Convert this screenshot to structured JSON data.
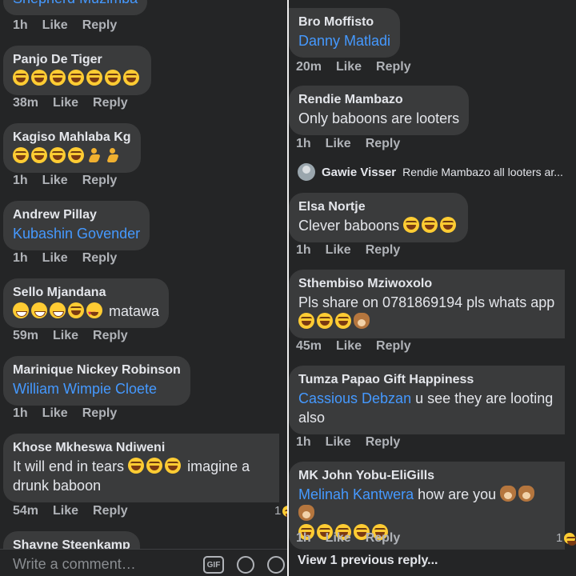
{
  "left": {
    "top_cut_author": "Shepherd Muzimba",
    "top_cut_actions": {
      "time": "1h",
      "like": "Like",
      "reply": "Reply"
    },
    "comments": [
      {
        "author": "Panjo De Tiger",
        "text": "",
        "mention": "",
        "time": "38m",
        "like": "Like",
        "reply": "Reply"
      },
      {
        "author": "Kagiso Mahlaba Kg",
        "text": "",
        "mention": "",
        "time": "1h",
        "like": "Like",
        "reply": "Reply"
      },
      {
        "author": "Andrew Pillay",
        "text": "",
        "mention": "Kubashin Govender",
        "time": "1h",
        "like": "Like",
        "reply": "Reply"
      },
      {
        "author": "Sello Mjandana",
        "text": "matawa",
        "mention": "",
        "time": "59m",
        "like": "Like",
        "reply": "Reply"
      },
      {
        "author": "Marinique Nickey Robinson",
        "text": "",
        "mention": "William Wimpie Cloete",
        "time": "1h",
        "like": "Like",
        "reply": "Reply"
      },
      {
        "author": "Khose Mkheswa Ndiweni",
        "text_a": "It will end in tears",
        "text_b": "imagine a",
        "text_c": "drunk baboon",
        "time": "54m",
        "like": "Like",
        "reply": "Reply",
        "reaction_count": "1"
      },
      {
        "author": "Shayne Steenkamp"
      }
    ],
    "composer": {
      "placeholder": "Write a comment…",
      "gif": "GIF"
    }
  },
  "right": {
    "comments": [
      {
        "author": "Bro Moffisto",
        "mention": "Danny Matladi",
        "time": "20m",
        "like": "Like",
        "reply": "Reply"
      },
      {
        "author": "Rendie Mambazo",
        "text": "Only baboons are looters",
        "time": "1h",
        "like": "Like",
        "reply": "Reply"
      },
      {
        "author": "Elsa Nortje",
        "text": "Clever baboons",
        "time": "1h",
        "like": "Like",
        "reply": "Reply"
      },
      {
        "author": "Sthembiso Mziwoxolo",
        "text": "Pls share on 0781869194 pls whats app",
        "time": "45m",
        "like": "Like",
        "reply": "Reply"
      },
      {
        "author": "Tumza Papao Gift Happiness",
        "mention": "Cassious Debzan",
        "text_a": "u see they are looting",
        "text_b": "also",
        "time": "1h",
        "like": "Like",
        "reply": "Reply"
      },
      {
        "author": "MK John Yobu-EliGills",
        "mention": "Melinah Kantwera",
        "text": "how are you",
        "time": "1h",
        "like": "Like",
        "reply": "Reply",
        "reaction_count": "1"
      }
    ],
    "reply_preview": {
      "name": "Gawie Visser",
      "snippet": "Rendie Mambazo all looters ar..."
    },
    "view_previous": "View 1 previous reply..."
  }
}
